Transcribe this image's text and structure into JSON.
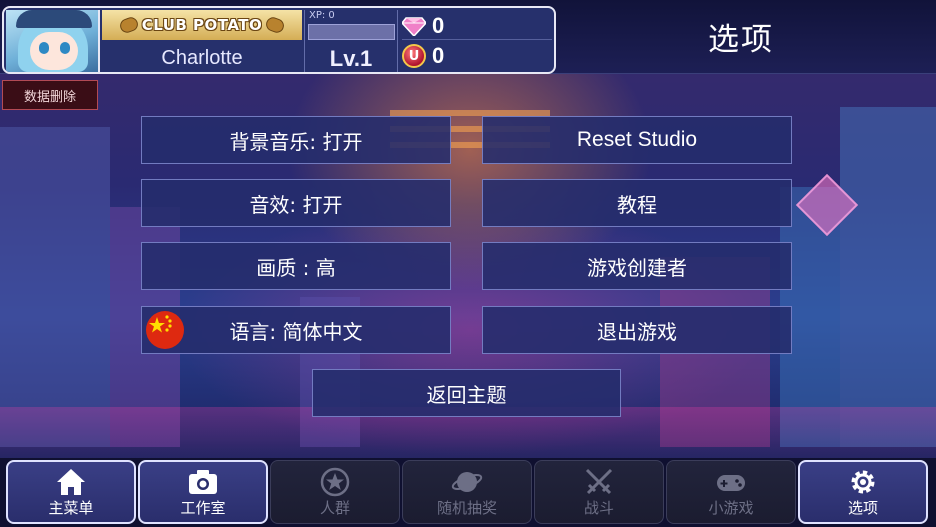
{
  "profile": {
    "club_name": "CLUB POTATO",
    "player_name": "Charlotte",
    "xp_label": "XP: 0",
    "xp_fraction": 0.0,
    "level": "Lv.1",
    "gems": "0",
    "coins": "0",
    "coin_symbol": "U"
  },
  "page_title": "选项",
  "delete_data_label": "数据删除",
  "options": {
    "music": "背景音乐: 打开",
    "reset_studio": "Reset Studio",
    "sound": "音效: 打开",
    "tutorial": "教程",
    "quality": "画质 : 高",
    "credits": "游戏创建者",
    "language": "语言: 简体中文",
    "quit": "退出游戏",
    "back": "返回主题"
  },
  "nav": [
    {
      "label": "主菜单",
      "icon": "home-icon",
      "state": "active"
    },
    {
      "label": "工作室",
      "icon": "camera-icon",
      "state": "active"
    },
    {
      "label": "人群",
      "icon": "star-icon",
      "state": "disabled"
    },
    {
      "label": "随机抽奖",
      "icon": "planet-icon",
      "state": "disabled"
    },
    {
      "label": "战斗",
      "icon": "crossed-swords-icon",
      "state": "disabled"
    },
    {
      "label": "小游戏",
      "icon": "gamepad-icon",
      "state": "disabled"
    },
    {
      "label": "选项",
      "icon": "gear-icon",
      "state": "active"
    }
  ],
  "colors": {
    "accent_border": "#dfe2ff",
    "button_fill": "#242c6c",
    "delete_button": "#3a0d16",
    "xp_fill": "#9ee86b"
  }
}
